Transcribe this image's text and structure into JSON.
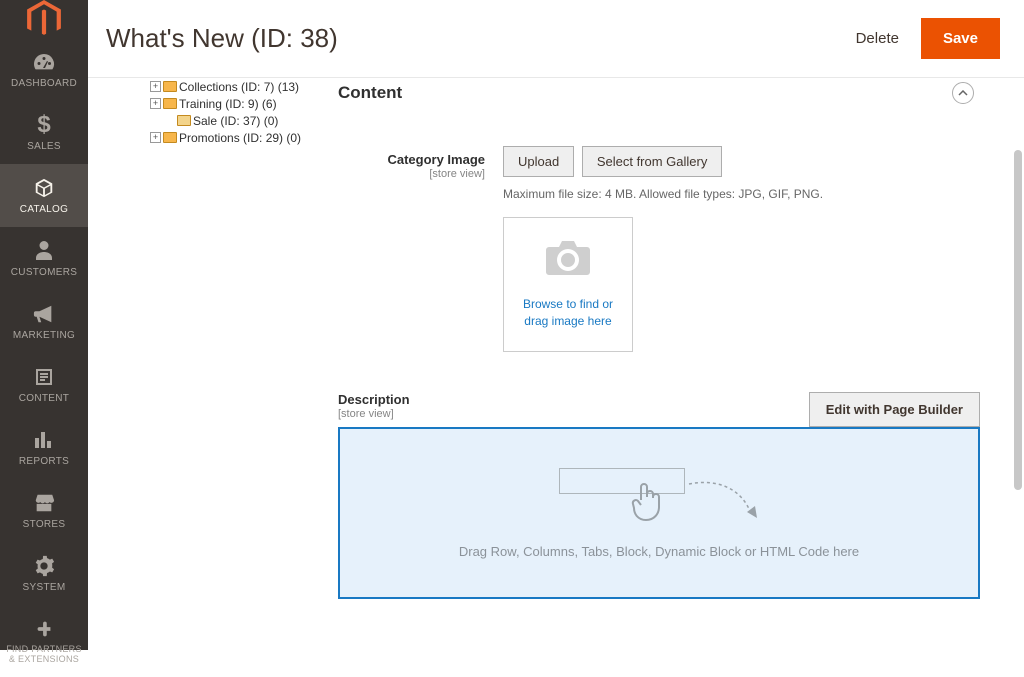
{
  "header": {
    "title": "What's New (ID: 38)",
    "delete": "Delete",
    "save": "Save"
  },
  "nav": {
    "dashboard": "DASHBOARD",
    "sales": "SALES",
    "catalog": "CATALOG",
    "customers": "CUSTOMERS",
    "marketing": "MARKETING",
    "content": "CONTENT",
    "reports": "REPORTS",
    "stores": "STORES",
    "system": "SYSTEM",
    "partners": "FIND PARTNERS & EXTENSIONS"
  },
  "tree": {
    "collections": "Collections (ID: 7) (13)",
    "training": "Training (ID: 9) (6)",
    "sale": "Sale (ID: 37) (0)",
    "promotions": "Promotions (ID: 29) (0)"
  },
  "section": {
    "title": "Content",
    "category_image_label": "Category Image",
    "scope": "[store view]",
    "upload": "Upload",
    "select_gallery": "Select from Gallery",
    "hint": "Maximum file size: 4 MB. Allowed file types: JPG, GIF, PNG.",
    "browse": "Browse to find or drag image here",
    "description_label": "Description",
    "edit_pb": "Edit with Page Builder",
    "pb_text": "Drag Row, Columns, Tabs, Block, Dynamic Block or HTML Code here"
  }
}
